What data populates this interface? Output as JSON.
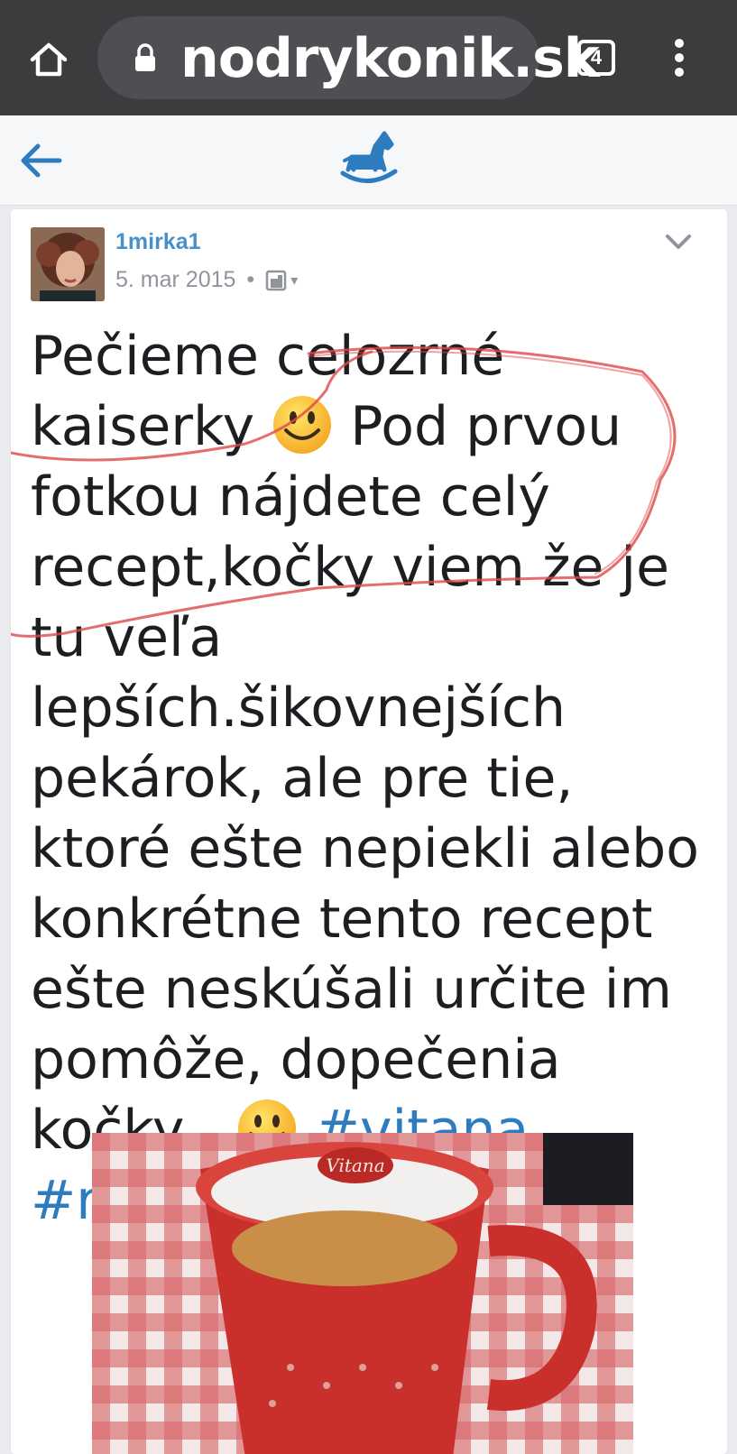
{
  "browser": {
    "url": "nodrykonik.sk",
    "tab_count": "4",
    "icons": {
      "home": "home-icon",
      "lock": "lock-icon",
      "menu": "more-vert-icon"
    }
  },
  "app_bar": {
    "icons": {
      "back": "arrow-left-icon",
      "logo": "rocking-horse-icon"
    },
    "accent_color": "#2e7cc0"
  },
  "post": {
    "author": "1mirka1",
    "date": "5. mar 2015",
    "separator": "•",
    "privacy": "▾",
    "text_segments": [
      "Pečieme celozrné kaiserky ",
      " Pod prvou fotkou nájdete celý recept,kočky viem že je tu veľa lepších.šikovnejších pekárok, ale pre tie, ktoré ešte nepiekli alebo konkrétne tento recept ešte neskúšali určite im pomôže, dopečenia kočky , ",
      " "
    ],
    "hashtags": [
      "#vitana",
      "#recept"
    ],
    "emoji": "smiling-face-emoji",
    "photo_logo": "Vitana",
    "scribble_color": "#e0484a"
  }
}
